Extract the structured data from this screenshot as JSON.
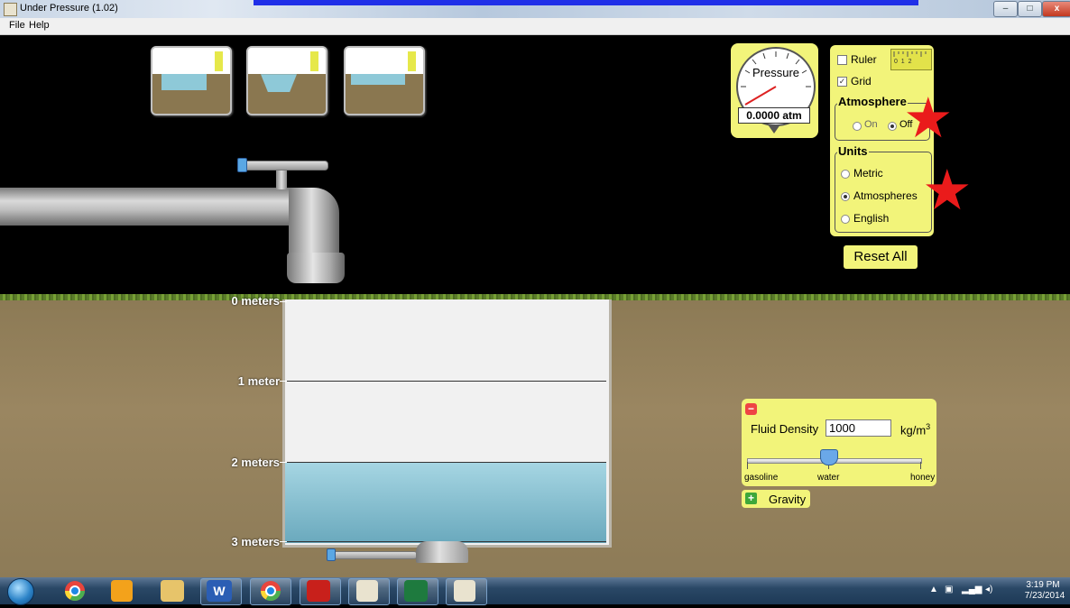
{
  "window": {
    "title": "Under Pressure (1.02)",
    "controls": {
      "minimize": "–",
      "maximize": "□",
      "close": "x"
    }
  },
  "menu": {
    "items": [
      {
        "label": "File"
      },
      {
        "label": "Help"
      }
    ]
  },
  "scene_thumbnails": [
    {
      "name": "scene-1-icon"
    },
    {
      "name": "scene-2-icon"
    },
    {
      "name": "scene-3-icon"
    }
  ],
  "pool": {
    "depth_labels": [
      "0 meters",
      "1 meter",
      "2 meters",
      "3 meters"
    ],
    "fluid_level_meters": 2.0
  },
  "pressure_gauge": {
    "title": "Pressure",
    "readout": "0.0000 atm"
  },
  "controls": {
    "ruler_label": "Ruler",
    "ruler_checked": false,
    "ruler_icon_text": "0  1  2",
    "grid_label": "Grid",
    "grid_checked": true,
    "atmosphere": {
      "title": "Atmosphere",
      "options": [
        "On",
        "Off"
      ],
      "selected": "Off"
    },
    "units": {
      "title": "Units",
      "options": [
        "Metric",
        "Atmospheres",
        "English"
      ],
      "selected": "Atmospheres"
    },
    "reset_label": "Reset All"
  },
  "fluid_density": {
    "collapse_symbol": "−",
    "label": "Fluid Density",
    "value": "1000",
    "unit": "kg/m",
    "unit_exponent": "3",
    "slider_labels": [
      "gasoline",
      "water",
      "honey"
    ],
    "slider_level_fraction": 0.45
  },
  "gravity": {
    "expand_symbol": "+",
    "label": "Gravity"
  },
  "taskbar": {
    "apps": [
      "start-orb",
      "chrome",
      "outlook",
      "file-explorer",
      "word",
      "chrome",
      "acrobat",
      "java",
      "excel",
      "java"
    ],
    "word_letter": "W",
    "time": "3:19 PM",
    "date": "7/23/2014"
  },
  "colors": {
    "panel": "#f2f47a",
    "water": "#6aa9bd",
    "ground": "#8c7a55",
    "star": "#ea1b1b"
  }
}
